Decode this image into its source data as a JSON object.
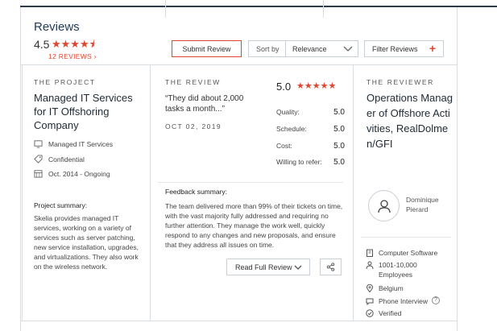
{
  "header": {
    "title": "Reviews",
    "rating": "4.5",
    "stars": "★★★★⯨",
    "reviews_link": "12 REVIEWS  ›"
  },
  "toolbar": {
    "submit_label": "Submit Review",
    "sort_label": "Sort by",
    "sort_value": "Relevance",
    "filter_label": "Filter Reviews",
    "filter_plus": "+"
  },
  "project": {
    "label": "THE PROJECT",
    "title": "Managed IT Services for IT Offshoring Company",
    "service": "Managed IT Services",
    "budget": "Confidential",
    "dates": "Oct. 2014 - Ongoing",
    "summary_heading": "Project summary:",
    "summary": "Skelia provides managed IT services, working on a variety of services such as server patching, new service installation, upgrades, and virtualizations. They also work on the wireless network."
  },
  "review": {
    "label": "THE REVIEW",
    "quote": "“They did about 2,000 tasks a month...”",
    "date": "OCT 02, 2019",
    "score": "5.0",
    "score_stars": "★★★★★",
    "scores": [
      {
        "label": "Quality:",
        "value": "5.0"
      },
      {
        "label": "Schedule:",
        "value": "5.0"
      },
      {
        "label": "Cost:",
        "value": "5.0"
      },
      {
        "label": "Willing to refer:",
        "value": "5.0"
      }
    ],
    "feedback_heading": "Feedback summary:",
    "feedback": "The team delivered more than 99% of their tickets on time, with the vast majority fully addressed and requiring no further attention. They manage the work well, quickly respond to any changes and new proposals, and ensure that they address all issues on time.",
    "read_full_label": "Read Full Review"
  },
  "reviewer": {
    "label": "THE REVIEWER",
    "title": "Operations Manager of Offshore Activities, RealDolmen/GFI",
    "name": "Dominique Pierard",
    "industry": "Computer Software",
    "employees": "1001-10,000 Employees",
    "location": "Belgium",
    "interview": "Phone Interview",
    "help": "?",
    "verified": "Verified"
  },
  "colors": {
    "accent": "#e0452f",
    "navy": "#1f3a57"
  }
}
